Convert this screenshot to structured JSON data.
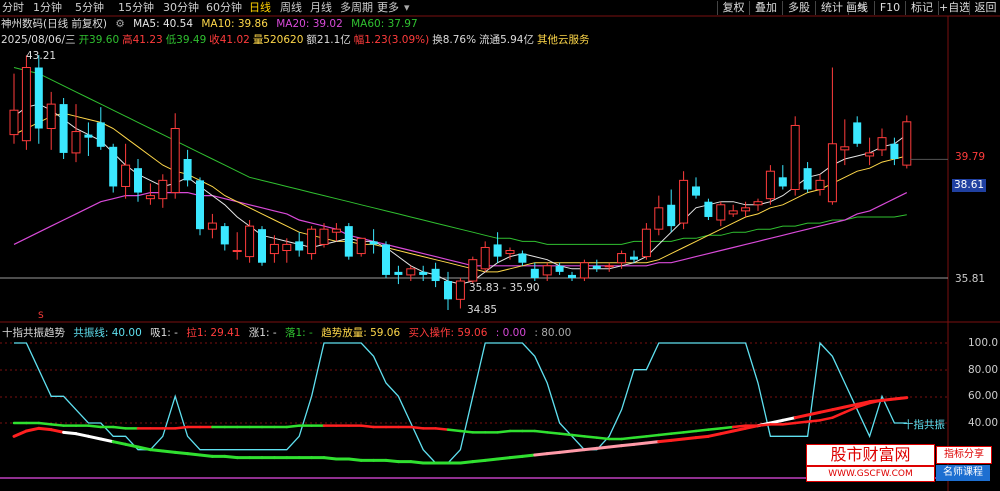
{
  "header": {
    "stock_name": "神州数码(日线 前复权)",
    "ma5": "MA5: 40.54",
    "ma10": "MA10: 39.86",
    "ma20": "MA20: 39.02",
    "ma60": "MA60: 37.97",
    "periods": [
      "分时",
      "1分钟",
      "5分钟",
      "15分钟",
      "30分钟",
      "60分钟",
      "日线",
      "周线",
      "月线",
      "多周期",
      "更多"
    ],
    "active_period": "日线",
    "toolbar": [
      "复权",
      "叠加",
      "多股",
      "统计",
      "画线",
      "F10",
      "标记",
      "+自选",
      "返回"
    ]
  },
  "info": {
    "date": "2025/08/06/三",
    "open": "开39.60",
    "high": "高41.23",
    "low": "低39.49",
    "close": "收41.02",
    "volume": "量520620",
    "amount": "额21.1亿",
    "amp": "幅1.23(3.09%)",
    "turnover": "换8.76%",
    "float": "流通5.94亿",
    "sector": "其他云服务"
  },
  "price_axis": {
    "labels": [
      "39.79",
      "38.61",
      "35.81"
    ],
    "current": "38.61"
  },
  "annotations": {
    "high_mark": "43.21",
    "low_mark": "34.85",
    "range_mark": "35.83 - 35.90",
    "s_mark": "S"
  },
  "indicator": {
    "name": "十指共振趋势",
    "line": "共振线: 40.00",
    "xi": "吸1: -",
    "la": "拉1: 29.41",
    "zhang": "涨1: -",
    "luo": "落1: -",
    "trend": "趋势放量: 59.06",
    "buy": "买入操作: 59.06",
    "v1": ": 0.00",
    "v2": ": 80.00",
    "axis": [
      "100.0",
      "80.00",
      "60.00",
      "40.00"
    ],
    "tag": "十指共振"
  },
  "watermark": {
    "title": "股市财富网",
    "url": "WWW.GSCFW.COM",
    "tag1": "指标分享",
    "tag2": "名师课程"
  },
  "colors": {
    "up": "#ff3c3c",
    "down": "#3be8ff",
    "ma5": "#e6e6e6",
    "ma10": "#ffd84a",
    "ma20": "#d84ad8",
    "ma60": "#30c030",
    "resonance": "#5fe0f0"
  },
  "chart_data": {
    "type": "candlestick",
    "candles": [
      {
        "o": 40.6,
        "h": 42.6,
        "l": 40.3,
        "c": 41.4
      },
      {
        "o": 40.4,
        "h": 43.2,
        "l": 40.1,
        "c": 42.8
      },
      {
        "o": 42.8,
        "h": 43.21,
        "l": 40.3,
        "c": 40.8
      },
      {
        "o": 40.8,
        "h": 42.0,
        "l": 40.1,
        "c": 41.6
      },
      {
        "o": 41.6,
        "h": 41.8,
        "l": 39.8,
        "c": 40.0
      },
      {
        "o": 40.0,
        "h": 41.6,
        "l": 39.7,
        "c": 40.7
      },
      {
        "o": 40.6,
        "h": 41.0,
        "l": 39.9,
        "c": 40.5
      },
      {
        "o": 41.0,
        "h": 41.5,
        "l": 40.1,
        "c": 40.2
      },
      {
        "o": 40.2,
        "h": 40.3,
        "l": 38.7,
        "c": 38.9
      },
      {
        "o": 38.9,
        "h": 40.3,
        "l": 38.5,
        "c": 39.6
      },
      {
        "o": 39.5,
        "h": 39.8,
        "l": 38.4,
        "c": 38.7
      },
      {
        "o": 38.5,
        "h": 39.0,
        "l": 38.3,
        "c": 38.6
      },
      {
        "o": 38.5,
        "h": 39.3,
        "l": 38.2,
        "c": 39.1
      },
      {
        "o": 38.7,
        "h": 41.3,
        "l": 38.5,
        "c": 40.8
      },
      {
        "o": 39.8,
        "h": 40.1,
        "l": 38.9,
        "c": 39.1
      },
      {
        "o": 39.1,
        "h": 39.2,
        "l": 37.3,
        "c": 37.5
      },
      {
        "o": 37.5,
        "h": 38.0,
        "l": 37.2,
        "c": 37.7
      },
      {
        "o": 37.6,
        "h": 37.7,
        "l": 36.8,
        "c": 37.0
      },
      {
        "o": 36.8,
        "h": 37.4,
        "l": 36.5,
        "c": 36.8
      },
      {
        "o": 36.6,
        "h": 37.8,
        "l": 36.4,
        "c": 37.6
      },
      {
        "o": 37.5,
        "h": 37.6,
        "l": 36.3,
        "c": 36.4
      },
      {
        "o": 36.7,
        "h": 37.3,
        "l": 36.4,
        "c": 37.0
      },
      {
        "o": 36.8,
        "h": 37.2,
        "l": 36.4,
        "c": 37.0
      },
      {
        "o": 37.1,
        "h": 37.4,
        "l": 36.6,
        "c": 36.8
      },
      {
        "o": 36.7,
        "h": 37.6,
        "l": 36.5,
        "c": 37.5
      },
      {
        "o": 37.0,
        "h": 37.7,
        "l": 36.9,
        "c": 37.5
      },
      {
        "o": 37.4,
        "h": 37.7,
        "l": 37.1,
        "c": 37.5
      },
      {
        "o": 37.6,
        "h": 37.7,
        "l": 36.5,
        "c": 36.6
      },
      {
        "o": 36.7,
        "h": 37.2,
        "l": 36.6,
        "c": 37.2
      },
      {
        "o": 37.1,
        "h": 37.5,
        "l": 36.7,
        "c": 37.0
      },
      {
        "o": 37.0,
        "h": 37.1,
        "l": 35.9,
        "c": 36.0
      },
      {
        "o": 36.1,
        "h": 36.3,
        "l": 35.7,
        "c": 36.0
      },
      {
        "o": 36.0,
        "h": 36.3,
        "l": 35.8,
        "c": 36.2
      },
      {
        "o": 36.1,
        "h": 36.3,
        "l": 35.8,
        "c": 36.0
      },
      {
        "o": 36.2,
        "h": 36.4,
        "l": 35.6,
        "c": 35.8
      },
      {
        "o": 35.8,
        "h": 36.1,
        "l": 34.85,
        "c": 35.2
      },
      {
        "o": 35.2,
        "h": 35.9,
        "l": 34.9,
        "c": 35.8
      },
      {
        "o": 35.8,
        "h": 36.6,
        "l": 35.7,
        "c": 36.5
      },
      {
        "o": 36.2,
        "h": 37.1,
        "l": 36.1,
        "c": 36.9
      },
      {
        "o": 37.0,
        "h": 37.4,
        "l": 36.4,
        "c": 36.6
      },
      {
        "o": 36.7,
        "h": 36.9,
        "l": 36.5,
        "c": 36.8
      },
      {
        "o": 36.7,
        "h": 36.8,
        "l": 36.3,
        "c": 36.4
      },
      {
        "o": 36.2,
        "h": 36.4,
        "l": 35.8,
        "c": 35.9
      },
      {
        "o": 36.0,
        "h": 36.4,
        "l": 35.8,
        "c": 36.3
      },
      {
        "o": 36.3,
        "h": 36.4,
        "l": 36.0,
        "c": 36.1
      },
      {
        "o": 36.0,
        "h": 36.1,
        "l": 35.8,
        "c": 35.9
      },
      {
        "o": 35.9,
        "h": 36.5,
        "l": 35.8,
        "c": 36.4
      },
      {
        "o": 36.3,
        "h": 36.5,
        "l": 36.1,
        "c": 36.2
      },
      {
        "o": 36.3,
        "h": 36.4,
        "l": 36.1,
        "c": 36.3
      },
      {
        "o": 36.4,
        "h": 36.8,
        "l": 36.2,
        "c": 36.7
      },
      {
        "o": 36.6,
        "h": 36.8,
        "l": 36.4,
        "c": 36.5
      },
      {
        "o": 36.6,
        "h": 37.7,
        "l": 36.5,
        "c": 37.5
      },
      {
        "o": 37.5,
        "h": 38.6,
        "l": 37.3,
        "c": 38.2
      },
      {
        "o": 38.3,
        "h": 38.8,
        "l": 37.4,
        "c": 37.6
      },
      {
        "o": 37.7,
        "h": 39.4,
        "l": 37.5,
        "c": 39.1
      },
      {
        "o": 38.9,
        "h": 39.2,
        "l": 38.5,
        "c": 38.6
      },
      {
        "o": 38.4,
        "h": 38.5,
        "l": 37.8,
        "c": 37.9
      },
      {
        "o": 37.8,
        "h": 38.4,
        "l": 37.6,
        "c": 38.3
      },
      {
        "o": 38.0,
        "h": 38.3,
        "l": 37.9,
        "c": 38.1
      },
      {
        "o": 38.1,
        "h": 38.4,
        "l": 37.9,
        "c": 38.2
      },
      {
        "o": 38.3,
        "h": 38.5,
        "l": 38.1,
        "c": 38.4
      },
      {
        "o": 38.5,
        "h": 39.6,
        "l": 38.3,
        "c": 39.4
      },
      {
        "o": 39.2,
        "h": 39.6,
        "l": 38.8,
        "c": 38.9
      },
      {
        "o": 38.8,
        "h": 41.2,
        "l": 38.6,
        "c": 40.9
      },
      {
        "o": 39.5,
        "h": 39.7,
        "l": 38.7,
        "c": 38.8
      },
      {
        "o": 38.8,
        "h": 39.3,
        "l": 38.6,
        "c": 39.1
      },
      {
        "o": 38.4,
        "h": 42.8,
        "l": 38.3,
        "c": 40.3
      },
      {
        "o": 40.1,
        "h": 41.1,
        "l": 39.6,
        "c": 40.2
      },
      {
        "o": 41.0,
        "h": 41.2,
        "l": 40.2,
        "c": 40.3
      },
      {
        "o": 39.9,
        "h": 40.5,
        "l": 39.6,
        "c": 40.0
      },
      {
        "o": 40.1,
        "h": 40.8,
        "l": 39.9,
        "c": 40.5
      },
      {
        "o": 40.3,
        "h": 40.5,
        "l": 39.6,
        "c": 39.8
      },
      {
        "o": 39.6,
        "h": 41.23,
        "l": 39.49,
        "c": 41.02
      }
    ],
    "ma5": [
      41.2,
      41.5,
      41.6,
      41.4,
      41.1,
      40.8,
      40.6,
      40.4,
      40.0,
      39.6,
      39.3,
      39.1,
      38.9,
      39.0,
      39.2,
      38.9,
      38.6,
      38.3,
      37.9,
      37.6,
      37.3,
      37.2,
      37.1,
      37.0,
      36.9,
      37.0,
      37.1,
      37.2,
      37.1,
      37.1,
      36.9,
      36.6,
      36.3,
      36.1,
      36.0,
      35.8,
      35.7,
      35.8,
      36.1,
      36.4,
      36.6,
      36.7,
      36.6,
      36.5,
      36.3,
      36.2,
      36.2,
      36.2,
      36.2,
      36.3,
      36.4,
      36.6,
      37.0,
      37.4,
      37.8,
      38.2,
      38.3,
      38.4,
      38.4,
      38.3,
      38.3,
      38.4,
      38.6,
      38.9,
      39.2,
      39.3,
      39.6,
      39.8,
      39.9,
      40.0,
      40.2,
      40.3,
      40.6
    ],
    "ma10": [
      40.6,
      40.8,
      41.0,
      41.2,
      41.3,
      41.2,
      41.1,
      41.0,
      40.8,
      40.5,
      40.2,
      39.9,
      39.6,
      39.4,
      39.3,
      39.1,
      38.9,
      38.6,
      38.4,
      38.2,
      38.0,
      37.8,
      37.6,
      37.4,
      37.3,
      37.2,
      37.1,
      37.1,
      37.0,
      37.0,
      36.9,
      36.8,
      36.7,
      36.6,
      36.5,
      36.4,
      36.3,
      36.2,
      36.1,
      36.1,
      36.2,
      36.3,
      36.4,
      36.4,
      36.4,
      36.4,
      36.4,
      36.4,
      36.4,
      36.4,
      36.4,
      36.4,
      36.5,
      36.7,
      36.9,
      37.1,
      37.3,
      37.5,
      37.7,
      37.9,
      38.0,
      38.2,
      38.3,
      38.5,
      38.7,
      38.8,
      39.0,
      39.2,
      39.4,
      39.5,
      39.7,
      39.8,
      39.9
    ],
    "ma20": [
      37.0,
      37.2,
      37.4,
      37.6,
      37.8,
      38.0,
      38.2,
      38.4,
      38.5,
      38.6,
      38.6,
      38.7,
      38.7,
      38.7,
      38.7,
      38.6,
      38.6,
      38.5,
      38.4,
      38.3,
      38.2,
      38.1,
      38.0,
      37.8,
      37.7,
      37.6,
      37.5,
      37.3,
      37.2,
      37.1,
      37.0,
      36.9,
      36.8,
      36.7,
      36.6,
      36.5,
      36.4,
      36.3,
      36.3,
      36.3,
      36.3,
      36.3,
      36.3,
      36.3,
      36.3,
      36.3,
      36.3,
      36.3,
      36.3,
      36.3,
      36.3,
      36.3,
      36.4,
      36.4,
      36.5,
      36.6,
      36.7,
      36.8,
      36.9,
      37.0,
      37.1,
      37.2,
      37.3,
      37.4,
      37.5,
      37.6,
      37.7,
      37.8,
      38.0,
      38.1,
      38.3,
      38.5,
      38.7
    ],
    "ma60": [
      42.8,
      42.7,
      42.6,
      42.4,
      42.2,
      42.0,
      41.8,
      41.6,
      41.4,
      41.2,
      41.0,
      40.8,
      40.6,
      40.4,
      40.2,
      40.0,
      39.8,
      39.6,
      39.4,
      39.2,
      39.1,
      39.0,
      38.9,
      38.8,
      38.7,
      38.6,
      38.5,
      38.4,
      38.3,
      38.2,
      38.1,
      38.0,
      37.9,
      37.8,
      37.7,
      37.6,
      37.5,
      37.4,
      37.3,
      37.2,
      37.2,
      37.1,
      37.1,
      37.0,
      37.0,
      37.0,
      37.0,
      37.0,
      37.0,
      37.0,
      37.1,
      37.1,
      37.1,
      37.1,
      37.2,
      37.2,
      37.3,
      37.3,
      37.4,
      37.4,
      37.5,
      37.5,
      37.6,
      37.6,
      37.7,
      37.7,
      37.8,
      37.8,
      37.9,
      37.9,
      37.9,
      37.9,
      37.97
    ],
    "resonance": [
      100,
      100,
      80,
      60,
      60,
      50,
      40,
      40,
      30,
      30,
      20,
      20,
      30,
      60,
      30,
      20,
      20,
      20,
      20,
      20,
      20,
      20,
      20,
      30,
      60,
      100,
      100,
      100,
      100,
      90,
      70,
      60,
      40,
      20,
      10,
      10,
      20,
      60,
      100,
      100,
      100,
      100,
      90,
      70,
      40,
      30,
      20,
      20,
      30,
      50,
      80,
      80,
      100,
      100,
      100,
      100,
      100,
      100,
      100,
      100,
      70,
      30,
      30,
      30,
      30,
      100,
      90,
      70,
      50,
      30,
      60,
      40,
      40
    ],
    "trend": [
      30,
      34,
      36,
      35,
      33,
      32,
      30,
      28,
      26,
      24,
      22,
      20,
      19,
      18,
      17,
      16,
      15,
      15,
      14,
      14,
      14,
      14,
      14,
      14,
      14,
      14,
      13,
      13,
      12,
      12,
      12,
      11,
      11,
      10,
      10,
      10,
      10,
      11,
      12,
      13,
      14,
      15,
      16,
      17,
      18,
      19,
      20,
      21,
      22,
      23,
      24,
      25,
      26,
      27,
      28,
      29,
      30,
      32,
      34,
      36,
      38,
      40,
      42,
      44,
      46,
      48,
      50,
      52,
      54,
      56,
      57,
      58,
      59.06
    ]
  }
}
